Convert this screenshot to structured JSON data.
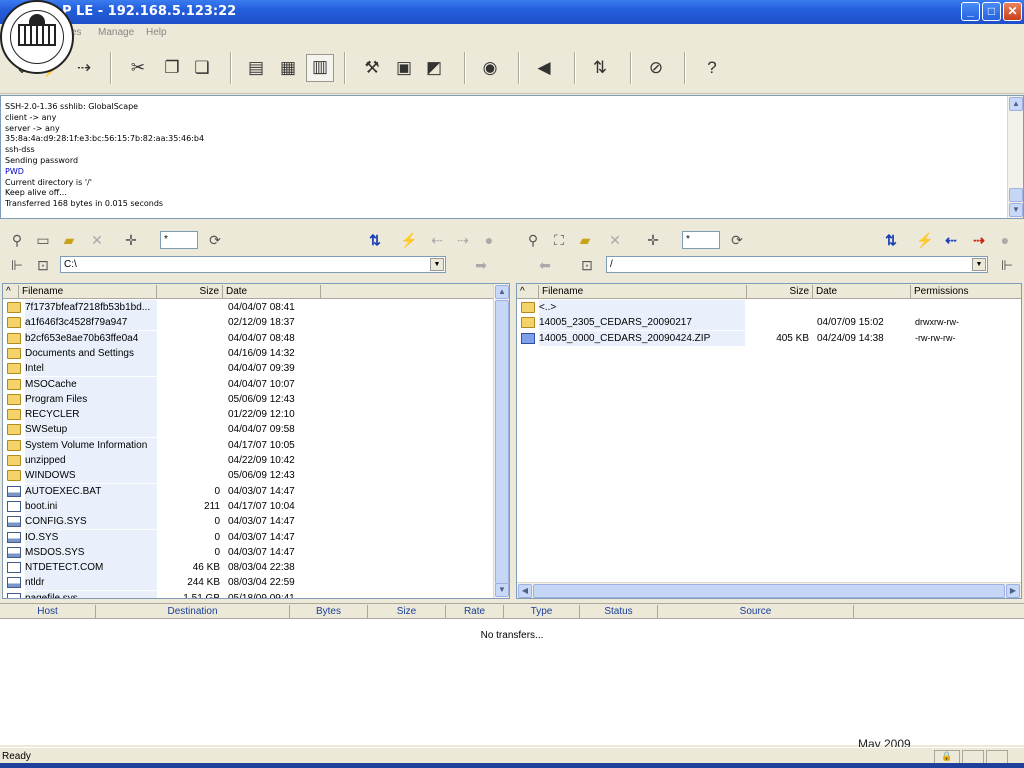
{
  "window": {
    "title": "P LE - 192.168.5.123:22",
    "controls": {
      "minimize": "_",
      "maximize": "□",
      "close": "✕"
    }
  },
  "seal": {
    "text": "SUPERINTENDENT OF PUBLIC INSTRUCTION · WASHINGTON"
  },
  "menu": {
    "items": [
      "ites",
      "Manage",
      "Help"
    ]
  },
  "toolbar": {
    "buttons": [
      {
        "icon": "connect-icon",
        "glyph": "⇓"
      },
      {
        "icon": "quick-connect-icon",
        "glyph": "⚡"
      },
      {
        "icon": "disconnect-icon",
        "glyph": "⇢"
      },
      {
        "icon": "cut-icon",
        "glyph": "✂"
      },
      {
        "icon": "copy-icon",
        "glyph": "❐"
      },
      {
        "icon": "paste-icon",
        "glyph": "❏"
      },
      {
        "icon": "view-list-icon",
        "glyph": "▤"
      },
      {
        "icon": "view-binary-icon",
        "glyph": "▦"
      },
      {
        "icon": "view-details-icon",
        "glyph": "▥"
      },
      {
        "icon": "tools-icon",
        "glyph": "⚒"
      },
      {
        "icon": "site-manager-icon",
        "glyph": "▣"
      },
      {
        "icon": "text-editor-icon",
        "glyph": "◩"
      },
      {
        "icon": "view-icon",
        "glyph": "◉"
      },
      {
        "icon": "sound-icon",
        "glyph": "◀"
      },
      {
        "icon": "sync-icon",
        "glyph": "⇅"
      },
      {
        "icon": "stop-icon",
        "glyph": "⊘"
      },
      {
        "icon": "help-icon",
        "glyph": "?"
      }
    ]
  },
  "log": {
    "lines": [
      {
        "text": "SSH-2.0-1.36 sshlib: GlobalScape",
        "cmd": false
      },
      {
        "text": "client -> any",
        "cmd": false
      },
      {
        "text": "server -> any",
        "cmd": false
      },
      {
        "text": "35:8a:4a:d9:28:1f:e3:bc:56:15:7b:82:aa:35:46:b4",
        "cmd": false
      },
      {
        "text": "ssh-dss",
        "cmd": false
      },
      {
        "text": "Sending password",
        "cmd": false
      },
      {
        "text": "PWD",
        "cmd": true
      },
      {
        "text": "Current directory is '/'",
        "cmd": false
      },
      {
        "text": "Keep alive off...",
        "cmd": false
      },
      {
        "text": "Transferred 168 bytes in 0.015 seconds",
        "cmd": false
      }
    ]
  },
  "local": {
    "filter": "*",
    "path": "C:\\",
    "columns": {
      "filename": "Filename",
      "size": "Size",
      "date": "Date"
    },
    "files": [
      {
        "name": "7f1737bfeaf7218fb53b1bd...",
        "size": "",
        "date": "04/04/07  08:41",
        "type": "folder"
      },
      {
        "name": "a1f646f3c4528f79a947",
        "size": "",
        "date": "02/12/09  18:37",
        "type": "folder"
      },
      {
        "name": "b2cf653e8ae70b63ffe0a4",
        "size": "",
        "date": "04/04/07  08:48",
        "type": "folder"
      },
      {
        "name": "Documents and Settings",
        "size": "",
        "date": "04/16/09  14:32",
        "type": "folder"
      },
      {
        "name": "Intel",
        "size": "",
        "date": "04/04/07  09:39",
        "type": "folder"
      },
      {
        "name": "MSOCache",
        "size": "",
        "date": "04/04/07  10:07",
        "type": "folder"
      },
      {
        "name": "Program Files",
        "size": "",
        "date": "05/06/09  12:43",
        "type": "folder"
      },
      {
        "name": "RECYCLER",
        "size": "",
        "date": "01/22/09  12:10",
        "type": "folder"
      },
      {
        "name": "SWSetup",
        "size": "",
        "date": "04/04/07  09:58",
        "type": "folder"
      },
      {
        "name": "System Volume Information",
        "size": "",
        "date": "04/17/07  10:05",
        "type": "folder"
      },
      {
        "name": "unzipped",
        "size": "",
        "date": "04/22/09  10:42",
        "type": "folder"
      },
      {
        "name": "WINDOWS",
        "size": "",
        "date": "05/06/09  12:43",
        "type": "folder"
      },
      {
        "name": "AUTOEXEC.BAT",
        "size": "0",
        "date": "04/03/07  14:47",
        "type": "sys"
      },
      {
        "name": "boot.ini",
        "size": "211",
        "date": "04/17/07  10:04",
        "type": "file"
      },
      {
        "name": "CONFIG.SYS",
        "size": "0",
        "date": "04/03/07  14:47",
        "type": "sys"
      },
      {
        "name": "IO.SYS",
        "size": "0",
        "date": "04/03/07  14:47",
        "type": "sys"
      },
      {
        "name": "MSDOS.SYS",
        "size": "0",
        "date": "04/03/07  14:47",
        "type": "sys"
      },
      {
        "name": "NTDETECT.COM",
        "size": "46 KB",
        "date": "08/03/04  22:38",
        "type": "file"
      },
      {
        "name": "ntldr",
        "size": "244 KB",
        "date": "08/03/04  22:59",
        "type": "sys"
      },
      {
        "name": "pagefile.sys",
        "size": "1.51 GB",
        "date": "05/18/09  09:41",
        "type": "sys"
      }
    ]
  },
  "remote": {
    "filter": "*",
    "path": "/",
    "columns": {
      "filename": "Filename",
      "size": "Size",
      "date": "Date",
      "permissions": "Permissions"
    },
    "files": [
      {
        "name": "<..>",
        "size": "",
        "date": "",
        "perms": "",
        "type": "folder"
      },
      {
        "name": "14005_2305_CEDARS_20090217",
        "size": "",
        "date": "04/07/09  15:02",
        "perms": "drwxrw-rw-",
        "type": "folder"
      },
      {
        "name": "14005_0000_CEDARS_20090424.ZIP",
        "size": "405 KB",
        "date": "04/24/09  14:38",
        "perms": "-rw-rw-rw-",
        "type": "zip"
      }
    ]
  },
  "transfers": {
    "columns": [
      "Host",
      "Destination",
      "Bytes",
      "Size",
      "Rate",
      "Type",
      "Status",
      "Source"
    ],
    "empty_text": "No transfers..."
  },
  "footer": {
    "watermark": "May 2009",
    "status": "Ready"
  }
}
